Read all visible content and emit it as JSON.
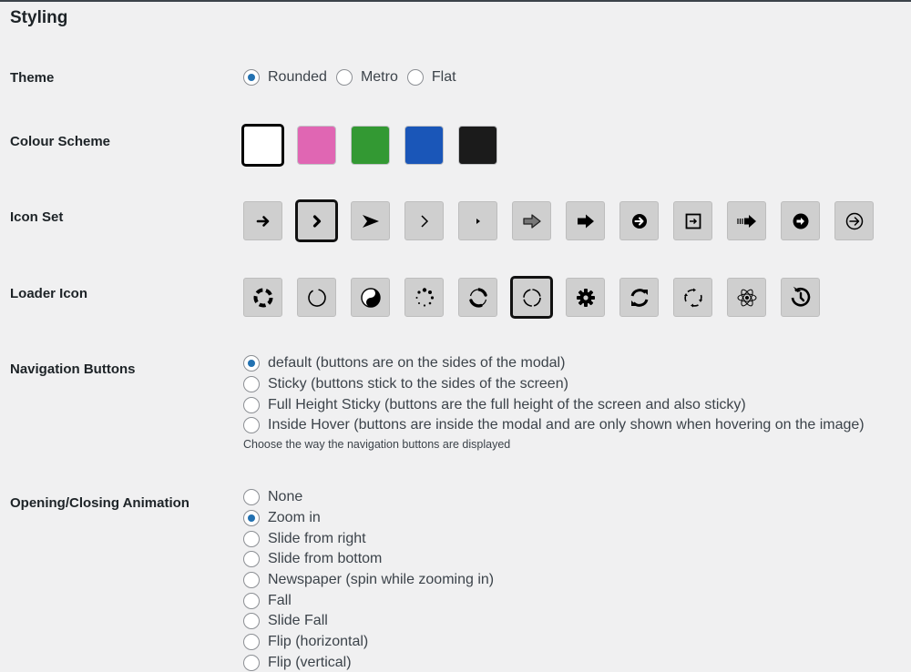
{
  "section_title": "Styling",
  "theme": {
    "label": "Theme",
    "options": [
      {
        "label": "Rounded",
        "checked": true
      },
      {
        "label": "Metro",
        "checked": false
      },
      {
        "label": "Flat",
        "checked": false
      }
    ]
  },
  "colour_scheme": {
    "label": "Colour Scheme",
    "swatches": [
      {
        "name": "white",
        "color": "#ffffff",
        "selected": true
      },
      {
        "name": "pink",
        "color": "#e066b3",
        "selected": false
      },
      {
        "name": "green",
        "color": "#339933",
        "selected": false
      },
      {
        "name": "blue",
        "color": "#1a56b8",
        "selected": false
      },
      {
        "name": "black",
        "color": "#1b1b1b",
        "selected": false
      }
    ]
  },
  "icon_set": {
    "label": "Icon Set",
    "icons": [
      {
        "icon": "arrow-right-icon",
        "selected": false
      },
      {
        "icon": "chevron-bold-right-icon",
        "selected": true
      },
      {
        "icon": "arrowhead-right-icon",
        "selected": false
      },
      {
        "icon": "chevron-thin-right-icon",
        "selected": false
      },
      {
        "icon": "caret-small-right-icon",
        "selected": false
      },
      {
        "icon": "outlined-arrow-right-icon",
        "selected": false
      },
      {
        "icon": "block-arrow-right-icon",
        "selected": false
      },
      {
        "icon": "circle-arrow-filled-right-icon",
        "selected": false
      },
      {
        "icon": "square-arrow-right-icon",
        "selected": false
      },
      {
        "icon": "fast-arrow-right-icon",
        "selected": false
      },
      {
        "icon": "circle-solid-arrow-right-icon",
        "selected": false
      },
      {
        "icon": "circle-outline-arrow-right-icon",
        "selected": false
      }
    ]
  },
  "loader_icon": {
    "label": "Loader Icon",
    "icons": [
      {
        "icon": "dashed-ring-loader-icon",
        "selected": false
      },
      {
        "icon": "thin-ring-loader-icon",
        "selected": false
      },
      {
        "icon": "yin-yang-loader-icon",
        "selected": false
      },
      {
        "icon": "dots-circle-loader-icon",
        "selected": false
      },
      {
        "icon": "double-arc-loader-icon",
        "selected": false
      },
      {
        "icon": "segmented-ring-loader-icon",
        "selected": true
      },
      {
        "icon": "gear-loader-icon",
        "selected": false
      },
      {
        "icon": "refresh-loader-icon",
        "selected": false
      },
      {
        "icon": "circular-arrows-loader-icon",
        "selected": false
      },
      {
        "icon": "atom-loader-icon",
        "selected": false
      },
      {
        "icon": "history-loader-icon",
        "selected": false
      }
    ]
  },
  "navigation_buttons": {
    "label": "Navigation Buttons",
    "options": [
      {
        "label": "default (buttons are on the sides of the modal)",
        "checked": true
      },
      {
        "label": "Sticky (buttons stick to the sides of the screen)",
        "checked": false
      },
      {
        "label": "Full Height Sticky (buttons are the full height of the screen and also sticky)",
        "checked": false
      },
      {
        "label": "Inside Hover (buttons are inside the modal and are only shown when hovering on the image)",
        "checked": false
      }
    ],
    "description": "Choose the way the navigation buttons are displayed"
  },
  "animation": {
    "label": "Opening/Closing Animation",
    "options": [
      {
        "label": "None",
        "checked": false
      },
      {
        "label": "Zoom in",
        "checked": true
      },
      {
        "label": "Slide from right",
        "checked": false
      },
      {
        "label": "Slide from bottom",
        "checked": false
      },
      {
        "label": "Newspaper (spin while zooming in)",
        "checked": false
      },
      {
        "label": "Fall",
        "checked": false
      },
      {
        "label": "Slide Fall",
        "checked": false
      },
      {
        "label": "Flip (horizontal)",
        "checked": false
      },
      {
        "label": "Flip (vertical)",
        "checked": false
      }
    ]
  }
}
